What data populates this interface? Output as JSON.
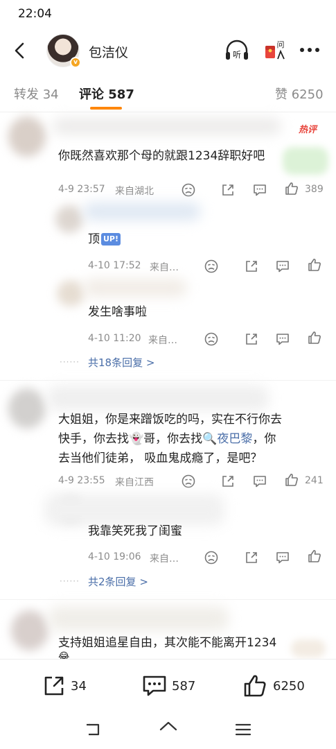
{
  "status": {
    "time": "22:04"
  },
  "header": {
    "title": "包洁仪",
    "listen_label": "听",
    "ask_label": "问"
  },
  "tabs": [
    {
      "label": "转发 34"
    },
    {
      "label": "评论 587"
    },
    {
      "label": "赞 6250"
    }
  ],
  "hot_label": "热评",
  "comments": [
    {
      "text": "你既然喜欢那个母的就跟1234辞职好吧",
      "time": "4-9 23:57",
      "location": "来自湖北",
      "likes": "389",
      "replies": [
        {
          "text": "顶",
          "badge": "UP!",
          "time": "4-10 17:52",
          "location": "来自…"
        },
        {
          "text": "发生啥事啦",
          "time": "4-10 11:20",
          "location": "来自…"
        }
      ],
      "more_replies": "共18条回复",
      "more_chevron": ">"
    },
    {
      "text_line1": "大姐姐，你是来蹭饭吃的吗，实在不行你去",
      "text_line2_a": "快手，你去找",
      "text_line2_b": "哥，你去找",
      "text_line2_link": "夜巴黎",
      "text_line2_c": "，你",
      "text_line3": "去当他们徒弟，  吸血鬼成瘾了，是吧？",
      "time": "4-9 23:55",
      "location": "来自江西",
      "likes": "241",
      "replies": [
        {
          "text": "我靠笑死我了闺蜜",
          "time": "4-10 19:06",
          "location": "来自…"
        }
      ],
      "more_replies": "共2条回复",
      "more_chevron": ">"
    },
    {
      "text": "支持姐姐追星自由，其次能不能离开1234"
    }
  ],
  "bottom_bar": {
    "repost_count": "34",
    "comment_count": "587",
    "like_count": "6250"
  },
  "colors": {
    "accent": "#ff8200",
    "link": "#4a6ea8",
    "hot": "#e8453c",
    "meta": "#8c8c8c"
  }
}
